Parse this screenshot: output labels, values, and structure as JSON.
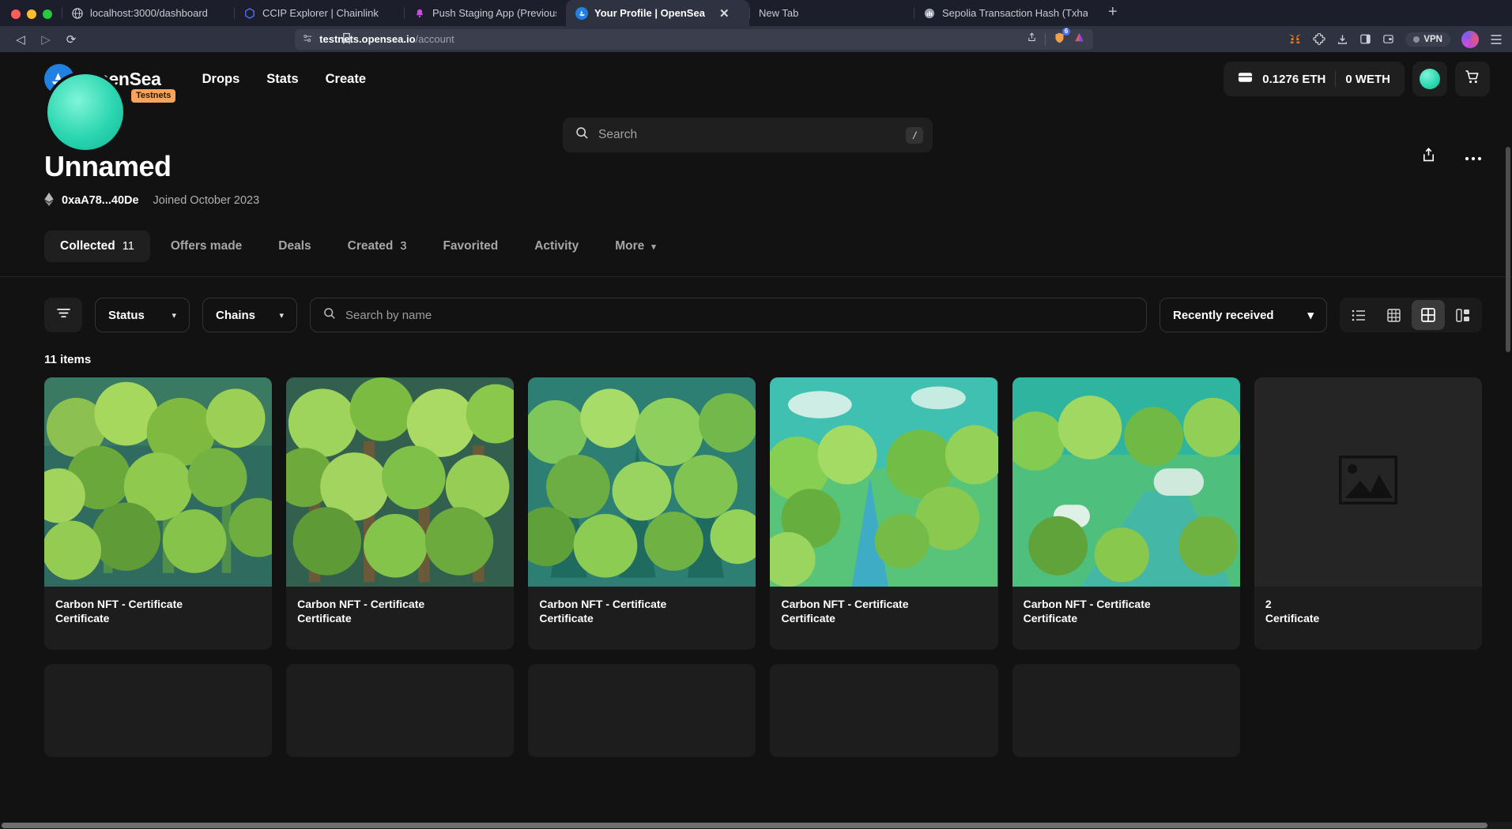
{
  "browser": {
    "tabs": [
      {
        "title": "localhost:3000/dashboard",
        "favicon": "globe-icon",
        "active": false
      },
      {
        "title": "CCIP Explorer | Chainlink",
        "favicon": "chainlink-icon",
        "active": false
      },
      {
        "title": "Push Staging App (Previously EPNS",
        "favicon": "push-bell-icon",
        "active": false
      },
      {
        "title": "Your Profile | OpenSea",
        "favicon": "opensea-icon",
        "active": true,
        "close_label": "✕"
      },
      {
        "title": "New Tab",
        "favicon": "",
        "active": false
      },
      {
        "title": "Sepolia Transaction Hash (Txhash) D",
        "favicon": "etherscan-icon",
        "active": false
      }
    ],
    "new_tab_label": "+",
    "nav": {
      "back": "◁",
      "forward": "▷",
      "reload": "⟳"
    },
    "url": {
      "prefix": "testnets.opensea.io",
      "suffix": "/account",
      "lock_icon": "permissions-icon",
      "bookmark_icon": "bookmark-icon"
    },
    "url_actions": {
      "share_icon": "share-icon",
      "shield_icon": "brave-shield-icon",
      "shield_count": "6",
      "leo_icon": "leo-ai-icon"
    },
    "extensions": [
      {
        "name": "metamask-icon",
        "glyph": "🦊"
      },
      {
        "name": "puzzle-extension-icon",
        "glyph": "✦"
      },
      {
        "name": "download-icon",
        "glyph": "⤓"
      },
      {
        "name": "sidebar-icon",
        "glyph": "▭"
      },
      {
        "name": "wallet-icon",
        "glyph": "▤"
      }
    ],
    "vpn_label": "VPN",
    "menu_icon": "hamburger-menu-icon"
  },
  "header": {
    "brand": "OpenSea",
    "badge": "Testnets",
    "nav": [
      {
        "label": "Drops"
      },
      {
        "label": "Stats"
      },
      {
        "label": "Create"
      }
    ],
    "search": {
      "placeholder": "Search",
      "value": "",
      "shortcut": "/"
    },
    "wallet": {
      "eth": "0.1276 ETH",
      "weth": "0 WETH"
    },
    "cart_icon": "cart-icon",
    "profile_icon": "profile-avatar"
  },
  "profile": {
    "name": "Unnamed",
    "address": "0xaA78...40De",
    "joined": "Joined October 2023",
    "share_icon": "share-icon",
    "more_icon": "more-options-icon"
  },
  "tabs": [
    {
      "label": "Collected",
      "count": "11",
      "active": true
    },
    {
      "label": "Offers made",
      "count": "",
      "active": false
    },
    {
      "label": "Deals",
      "count": "",
      "active": false
    },
    {
      "label": "Created",
      "count": "3",
      "active": false
    },
    {
      "label": "Favorited",
      "count": "",
      "active": false
    },
    {
      "label": "Activity",
      "count": "",
      "active": false
    },
    {
      "label": "More",
      "count": "",
      "active": false,
      "chevron": true
    }
  ],
  "filters": {
    "filter_icon": "filter-icon",
    "status": {
      "label": "Status"
    },
    "chains": {
      "label": "Chains"
    },
    "name_search": {
      "placeholder": "Search by name",
      "value": ""
    },
    "sort": {
      "label": "Recently received"
    },
    "views": [
      {
        "name": "list-view-icon",
        "active": false
      },
      {
        "name": "small-grid-view-icon",
        "active": false
      },
      {
        "name": "large-grid-view-icon",
        "active": true
      },
      {
        "name": "detail-view-icon",
        "active": false
      }
    ]
  },
  "results": {
    "count_label": "11 items",
    "items": [
      {
        "title": "Carbon NFT - Certificate",
        "subtitle": "Certificate",
        "art": "forest-a",
        "placeholder": false
      },
      {
        "title": "Carbon NFT - Certificate",
        "subtitle": "Certificate",
        "art": "forest-b",
        "placeholder": false
      },
      {
        "title": "Carbon NFT - Certificate",
        "subtitle": "Certificate",
        "art": "forest-c",
        "placeholder": false
      },
      {
        "title": "Carbon NFT - Certificate",
        "subtitle": "Certificate",
        "art": "forest-d",
        "placeholder": false
      },
      {
        "title": "Carbon NFT - Certificate",
        "subtitle": "Certificate",
        "art": "forest-e",
        "placeholder": false
      },
      {
        "title": "2",
        "subtitle": "Certificate",
        "art": "",
        "placeholder": true
      }
    ]
  }
}
